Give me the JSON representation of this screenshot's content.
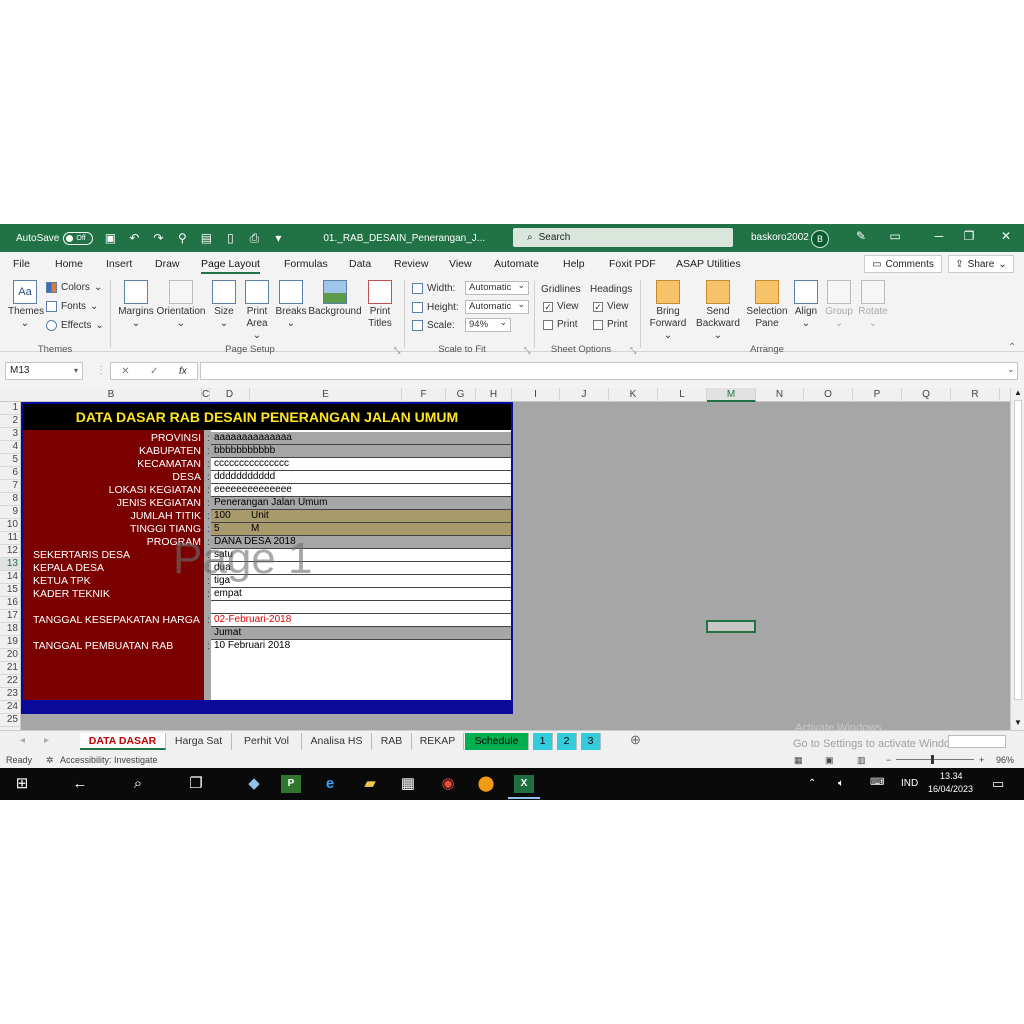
{
  "titlebar": {
    "autosave_label": "AutoSave",
    "autosave_state": "Off",
    "filename": "01._RAB_DESAIN_Penerangan_J...",
    "search_placeholder": "Search",
    "user_name": "baskoro2002",
    "user_initial": "B"
  },
  "menu": {
    "items": [
      "File",
      "Home",
      "Insert",
      "Draw",
      "Page Layout",
      "Formulas",
      "Data",
      "Review",
      "View",
      "Automate",
      "Help",
      "Foxit PDF",
      "ASAP Utilities"
    ],
    "active": "Page Layout",
    "comments_label": "Comments",
    "share_label": "Share"
  },
  "ribbon": {
    "themes": {
      "themes_label": "Themes",
      "colors_label": "Colors",
      "fonts_label": "Fonts",
      "effects_label": "Effects",
      "group_label": "Themes"
    },
    "page_setup": {
      "margins": "Margins",
      "orientation": "Orientation",
      "size": "Size",
      "print_area_1": "Print",
      "print_area_2": "Area",
      "breaks": "Breaks",
      "background": "Background",
      "print_titles_1": "Print",
      "print_titles_2": "Titles",
      "group_label": "Page Setup"
    },
    "scale_to_fit": {
      "width_label": "Width:",
      "width_value": "Automatic",
      "height_label": "Height:",
      "height_value": "Automatic",
      "scale_label": "Scale:",
      "scale_value": "94%",
      "group_label": "Scale to Fit"
    },
    "sheet_options": {
      "gridlines": "Gridlines",
      "headings": "Headings",
      "view": "View",
      "print": "Print",
      "group_label": "Sheet Options"
    },
    "arrange": {
      "bring_1": "Bring",
      "bring_2": "Forward",
      "send_1": "Send",
      "send_2": "Backward",
      "selection_1": "Selection",
      "selection_2": "Pane",
      "align": "Align",
      "group": "Group",
      "rotate": "Rotate",
      "group_label": "Arrange"
    }
  },
  "formula_bar": {
    "name_box": "M13",
    "fx": "fx",
    "value": ""
  },
  "columns": [
    "B",
    "C",
    "D",
    "E",
    "F",
    "G",
    "H",
    "I",
    "J",
    "K",
    "L",
    "M",
    "N",
    "O",
    "P",
    "Q",
    "R"
  ],
  "rows": [
    "1",
    "2",
    "3",
    "4",
    "5",
    "6",
    "7",
    "8",
    "9",
    "10",
    "11",
    "12",
    "13",
    "14",
    "15",
    "16",
    "17",
    "18",
    "19",
    "20",
    "21",
    "22",
    "23",
    "24",
    "25"
  ],
  "sheet": {
    "title": "DATA DASAR RAB DESAIN PENERANGAN JALAN UMUM",
    "watermark": "Page 1",
    "fields": [
      {
        "label": "PROVINSI",
        "value": "aaaaaaaaaaaaaa"
      },
      {
        "label": "KABUPATEN",
        "value": "bbbbbbbbbbb"
      },
      {
        "label": "KECAMATAN",
        "value": "ccccccccccccccc"
      },
      {
        "label": "DESA",
        "value": "ddddddddddd"
      },
      {
        "label": "LOKASI KEGIATAN",
        "value": "eeeeeeeeeeeeee"
      },
      {
        "label": "JENIS KEGIATAN",
        "value": "Penerangan Jalan Umum"
      },
      {
        "label": "JUMLAH TITIK",
        "value": "100",
        "unit": "Unit"
      },
      {
        "label": "TINGGI TIANG",
        "value": "5",
        "unit": "M"
      },
      {
        "label": "PROGRAM",
        "value": "DANA DESA 2018"
      },
      {
        "label": "SEKERTARIS DESA",
        "value": "satu"
      },
      {
        "label": "KEPALA DESA",
        "value": "dua"
      },
      {
        "label": "KETUA TPK",
        "value": "tiga"
      },
      {
        "label": "KADER TEKNIK",
        "value": "empat"
      },
      {
        "label": "TANGGAL KESEPAKATAN HARGA",
        "value": "02-Februari-2018",
        "day": "Jumat"
      },
      {
        "label": "TANGGAL PEMBUATAN RAB",
        "value": "10 Februari 2018"
      }
    ],
    "colon": ":"
  },
  "tabs": [
    "DATA DASAR",
    "Harga Sat",
    "Perhit Vol",
    "Analisa HS",
    "RAB",
    "REKAP",
    "Schedule",
    "1",
    "2",
    "3"
  ],
  "activate": {
    "line1": "Activate Windows",
    "line2": "Go to Settings to activate Windows."
  },
  "status": {
    "ready": "Ready",
    "accessibility": "Accessibility: Investigate",
    "zoom": "96%"
  },
  "taskbar": {
    "lang": "IND",
    "time": "13.34",
    "date": "16/04/2023"
  },
  "colors": {
    "excel_green": "#217346",
    "maroon": "#7b0000",
    "title_yellow": "#ffe51f",
    "border_blue": "#0a0a9a"
  }
}
